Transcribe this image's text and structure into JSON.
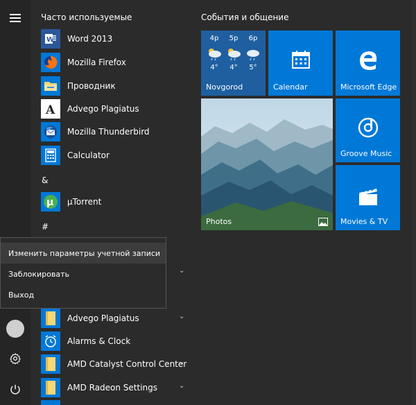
{
  "colors": {
    "accent": "#0078d7",
    "background": "#2b2b2b",
    "rail": "#252525"
  },
  "sections": {
    "frequent": "Часто используемые",
    "events": "События и общение"
  },
  "frequent_apps": [
    {
      "label": "Word 2013",
      "icon": "word-icon"
    },
    {
      "label": "Mozilla Firefox",
      "icon": "firefox-icon"
    },
    {
      "label": "Проводник",
      "icon": "explorer-icon"
    },
    {
      "label": "Advego Plagiatus",
      "icon": "advego-icon"
    },
    {
      "label": "Mozilla Thunderbird",
      "icon": "thunderbird-icon"
    },
    {
      "label": "Calculator",
      "icon": "calculator-icon"
    }
  ],
  "groups": {
    "amp": "&",
    "hash": "#"
  },
  "amp_apps": [
    {
      "label": "µTorrent",
      "icon": "utorrent-icon"
    }
  ],
  "lower_apps": [
    {
      "label": "Advego Plagiatus",
      "icon": "folder-icon"
    },
    {
      "label": "Alarms & Clock",
      "icon": "alarm-clock-icon"
    },
    {
      "label": "AMD Catalyst Control Center",
      "icon": "folder-icon"
    },
    {
      "label": "AMD Radeon Settings",
      "icon": "folder-icon"
    }
  ],
  "account_menu": {
    "change": "Изменить параметры учетной записи",
    "lock": "Заблокировать",
    "signout": "Выход"
  },
  "tiles": {
    "weather": {
      "label": "Novgorod",
      "days": [
        {
          "time": "4р",
          "temp": "4°"
        },
        {
          "time": "5р",
          "temp": "4°"
        },
        {
          "time": "6р",
          "temp": "5°"
        }
      ]
    },
    "calendar": "Calendar",
    "edge": "Microsoft Edge",
    "photos": "Photos",
    "groove": "Groove Music",
    "movies": "Movies & TV"
  }
}
